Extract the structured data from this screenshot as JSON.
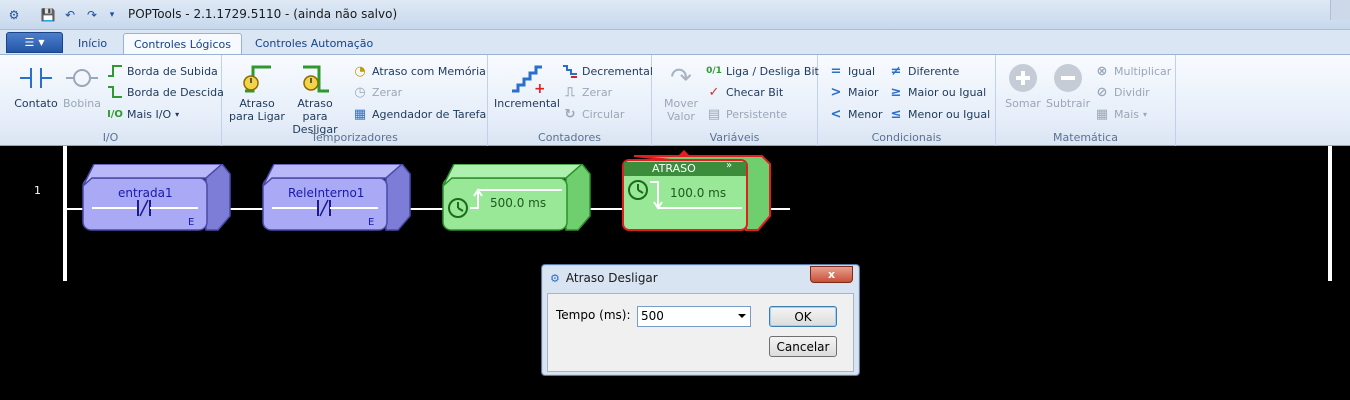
{
  "window": {
    "title": "POPTools - 2.1.1729.5110 - (ainda não salvo)"
  },
  "tabs": [
    {
      "label": "Início"
    },
    {
      "label": "Controles Lógicos"
    },
    {
      "label": "Controles Automação"
    }
  ],
  "ribbon": {
    "io": {
      "label": "I/O",
      "contato": "Contato",
      "bobina": "Bobina",
      "borda_subida": "Borda de Subida",
      "borda_descida": "Borda de Descida",
      "mais_io": "Mais I/O"
    },
    "temporizadores": {
      "label": "Temporizadores",
      "atraso_ligar": "Atraso para Ligar",
      "atraso_desligar": "Atraso para Desligar",
      "atraso_memoria": "Atraso com Memória",
      "zerar": "Zerar",
      "agendador": "Agendador de Tarefa"
    },
    "contadores": {
      "label": "Contadores",
      "incremental": "Incremental",
      "decremental": "Decremental",
      "zerar": "Zerar",
      "circular": "Circular"
    },
    "variaveis": {
      "label": "Variáveis",
      "mover_valor": "Mover Valor",
      "liga_desliga": "Liga / Desliga Bit",
      "checar_bit": "Checar Bit",
      "persistente": "Persistente"
    },
    "condicionais": {
      "label": "Condicionais",
      "igual": "Igual",
      "maior": "Maior",
      "menor": "Menor",
      "diferente": "Diferente",
      "maior_igual": "Maior ou Igual",
      "menor_igual": "Menor ou Igual"
    },
    "matematica": {
      "label": "Matemática",
      "somar": "Somar",
      "subtrair": "Subtrair",
      "multiplicar": "Multiplicar",
      "dividir": "Dividir",
      "mais": "Mais"
    }
  },
  "ladder": {
    "rung_number": "1",
    "blocks": [
      {
        "name": "entrada1",
        "tag": "E"
      },
      {
        "name": "ReleInterno1",
        "tag": "E"
      },
      {
        "time": "500.0 ms"
      },
      {
        "header": "ATRASO",
        "time": "100.0 ms"
      }
    ]
  },
  "dialog": {
    "title": "Atraso Desligar",
    "close": "x",
    "field_label": "Tempo (ms):",
    "field_value": "500",
    "ok": "OK",
    "cancel": "Cancelar"
  },
  "colors": {
    "contact_fill": "#a9a9f5",
    "timer_fill": "#98e898",
    "selected_border": "#e02020",
    "ribbon_blue": "#15428b"
  }
}
